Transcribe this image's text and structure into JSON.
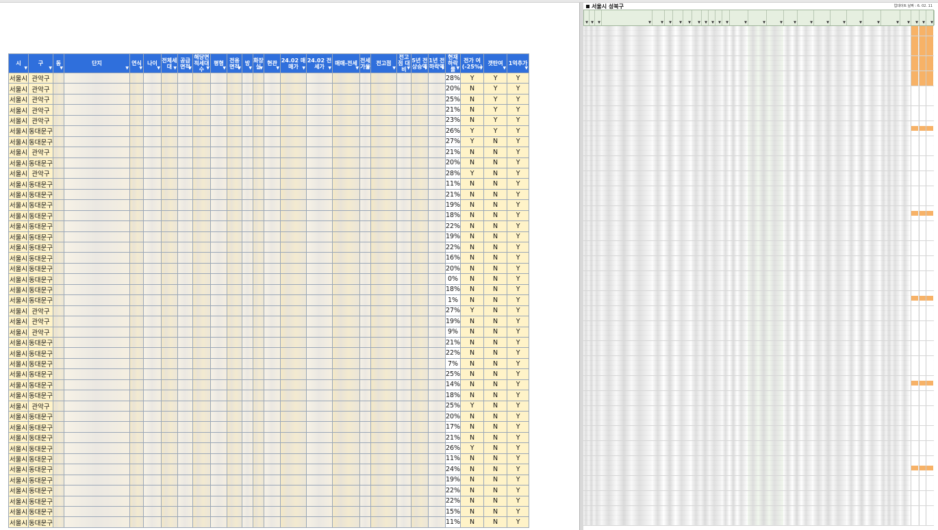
{
  "left_sheet": {
    "headers": [
      "시",
      "구",
      "동",
      "단지",
      "연식",
      "나이",
      "전체세대",
      "공급면적",
      "해당면적세대수",
      "평형",
      "전용면적",
      "방",
      "화장실",
      "현관",
      "24.02 매매가",
      "24.02 전세가",
      "매매-전세",
      "전세가율",
      "전고점",
      "전고점 대비",
      "5년 전 상승액",
      "1년 전 하락액",
      "현재 하락률",
      "전가 여 (-25%)",
      "갯탄여",
      "1억추가"
    ],
    "rows": [
      [
        "서울시",
        "관악구",
        "28%",
        "Y",
        "Y",
        "Y"
      ],
      [
        "서울시",
        "관악구",
        "20%",
        "N",
        "Y",
        "Y"
      ],
      [
        "서울시",
        "관악구",
        "25%",
        "N",
        "Y",
        "Y"
      ],
      [
        "서울시",
        "관악구",
        "21%",
        "N",
        "Y",
        "Y"
      ],
      [
        "서울시",
        "관악구",
        "23%",
        "N",
        "Y",
        "Y"
      ],
      [
        "서울시",
        "동대문구",
        "26%",
        "Y",
        "Y",
        "Y"
      ],
      [
        "서울시",
        "동대문구",
        "27%",
        "Y",
        "N",
        "Y"
      ],
      [
        "서울시",
        "관악구",
        "21%",
        "N",
        "N",
        "Y"
      ],
      [
        "서울시",
        "동대문구",
        "20%",
        "N",
        "N",
        "Y"
      ],
      [
        "서울시",
        "관악구",
        "28%",
        "Y",
        "N",
        "Y"
      ],
      [
        "서울시",
        "동대문구",
        "11%",
        "N",
        "N",
        "Y"
      ],
      [
        "서울시",
        "동대문구",
        "21%",
        "N",
        "N",
        "Y"
      ],
      [
        "서울시",
        "동대문구",
        "19%",
        "N",
        "N",
        "Y"
      ],
      [
        "서울시",
        "동대문구",
        "18%",
        "N",
        "N",
        "Y"
      ],
      [
        "서울시",
        "동대문구",
        "22%",
        "N",
        "N",
        "Y"
      ],
      [
        "서울시",
        "동대문구",
        "19%",
        "N",
        "N",
        "Y"
      ],
      [
        "서울시",
        "동대문구",
        "22%",
        "N",
        "N",
        "Y"
      ],
      [
        "서울시",
        "동대문구",
        "16%",
        "N",
        "N",
        "Y"
      ],
      [
        "서울시",
        "동대문구",
        "20%",
        "N",
        "N",
        "Y"
      ],
      [
        "서울시",
        "동대문구",
        "0%",
        "N",
        "N",
        "Y"
      ],
      [
        "서울시",
        "동대문구",
        "18%",
        "N",
        "N",
        "Y"
      ],
      [
        "서울시",
        "동대문구",
        "1%",
        "N",
        "N",
        "Y"
      ],
      [
        "서울시",
        "관악구",
        "27%",
        "Y",
        "N",
        "Y"
      ],
      [
        "서울시",
        "관악구",
        "19%",
        "N",
        "N",
        "Y"
      ],
      [
        "서울시",
        "관악구",
        "9%",
        "N",
        "N",
        "Y"
      ],
      [
        "서울시",
        "동대문구",
        "21%",
        "N",
        "N",
        "Y"
      ],
      [
        "서울시",
        "동대문구",
        "22%",
        "N",
        "N",
        "Y"
      ],
      [
        "서울시",
        "동대문구",
        "7%",
        "N",
        "N",
        "Y"
      ],
      [
        "서울시",
        "동대문구",
        "25%",
        "N",
        "N",
        "Y"
      ],
      [
        "서울시",
        "동대문구",
        "14%",
        "N",
        "N",
        "Y"
      ],
      [
        "서울시",
        "동대문구",
        "18%",
        "N",
        "N",
        "Y"
      ],
      [
        "서울시",
        "관악구",
        "25%",
        "Y",
        "N",
        "Y"
      ],
      [
        "서울시",
        "동대문구",
        "20%",
        "N",
        "N",
        "Y"
      ],
      [
        "서울시",
        "동대문구",
        "17%",
        "N",
        "N",
        "Y"
      ],
      [
        "서울시",
        "동대문구",
        "21%",
        "N",
        "N",
        "Y"
      ],
      [
        "서울시",
        "동대문구",
        "26%",
        "Y",
        "N",
        "Y"
      ],
      [
        "서울시",
        "동대문구",
        "11%",
        "N",
        "N",
        "Y"
      ],
      [
        "서울시",
        "동대문구",
        "24%",
        "N",
        "N",
        "Y"
      ],
      [
        "서울시",
        "동대문구",
        "19%",
        "N",
        "N",
        "Y"
      ],
      [
        "서울시",
        "동대문구",
        "22%",
        "N",
        "N",
        "Y"
      ],
      [
        "서울시",
        "동대문구",
        "22%",
        "N",
        "N",
        "Y"
      ],
      [
        "서울시",
        "동대문구",
        "15%",
        "N",
        "N",
        "Y"
      ],
      [
        "서울시",
        "동대문구",
        "11%",
        "N",
        "N",
        "Y"
      ]
    ]
  },
  "right_sheet": {
    "title": "서울시 성북구",
    "date_label": "업데이트 날짜 : 6. 02. 11",
    "row_count": 100
  },
  "colors": {
    "header_blue": "#2f6fdc",
    "cell_yellow": "#fff3c8",
    "flag_orange": "#f7b267",
    "flag_red": "#d9342b"
  }
}
